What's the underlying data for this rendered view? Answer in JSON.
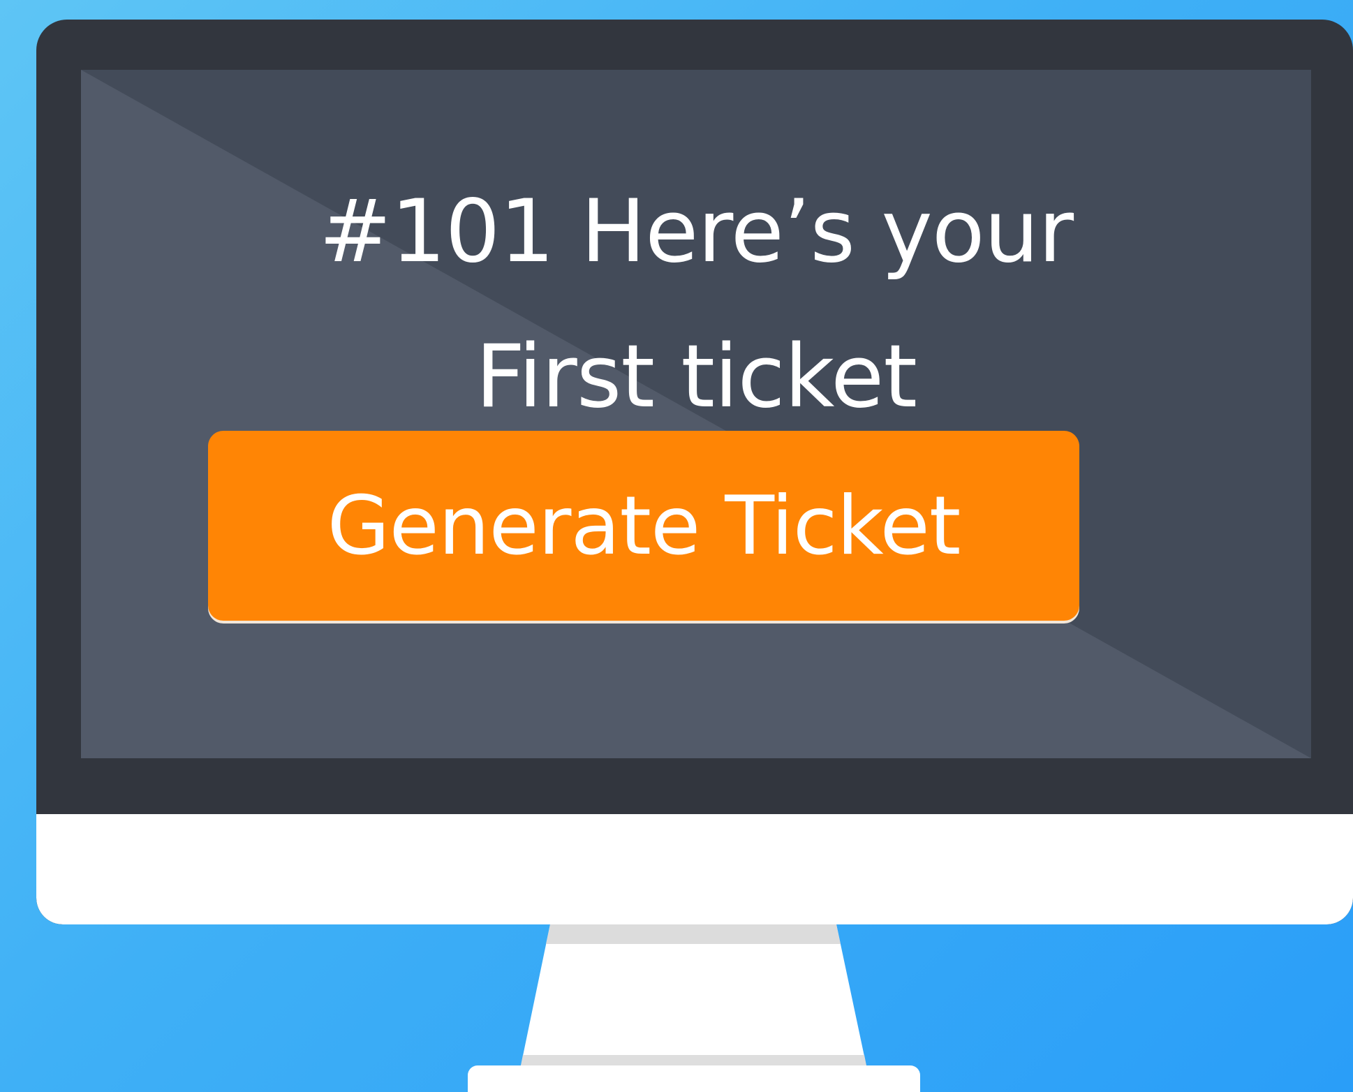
{
  "screen": {
    "headline_line1": "#101 Here’s your",
    "headline_line2": "First ticket",
    "button_label": "Generate Ticket"
  },
  "colors": {
    "background": "#3fb0f6",
    "bezel": "#32363e",
    "screen": "#434b59",
    "button": "#ff8505",
    "text": "#ffffff"
  }
}
